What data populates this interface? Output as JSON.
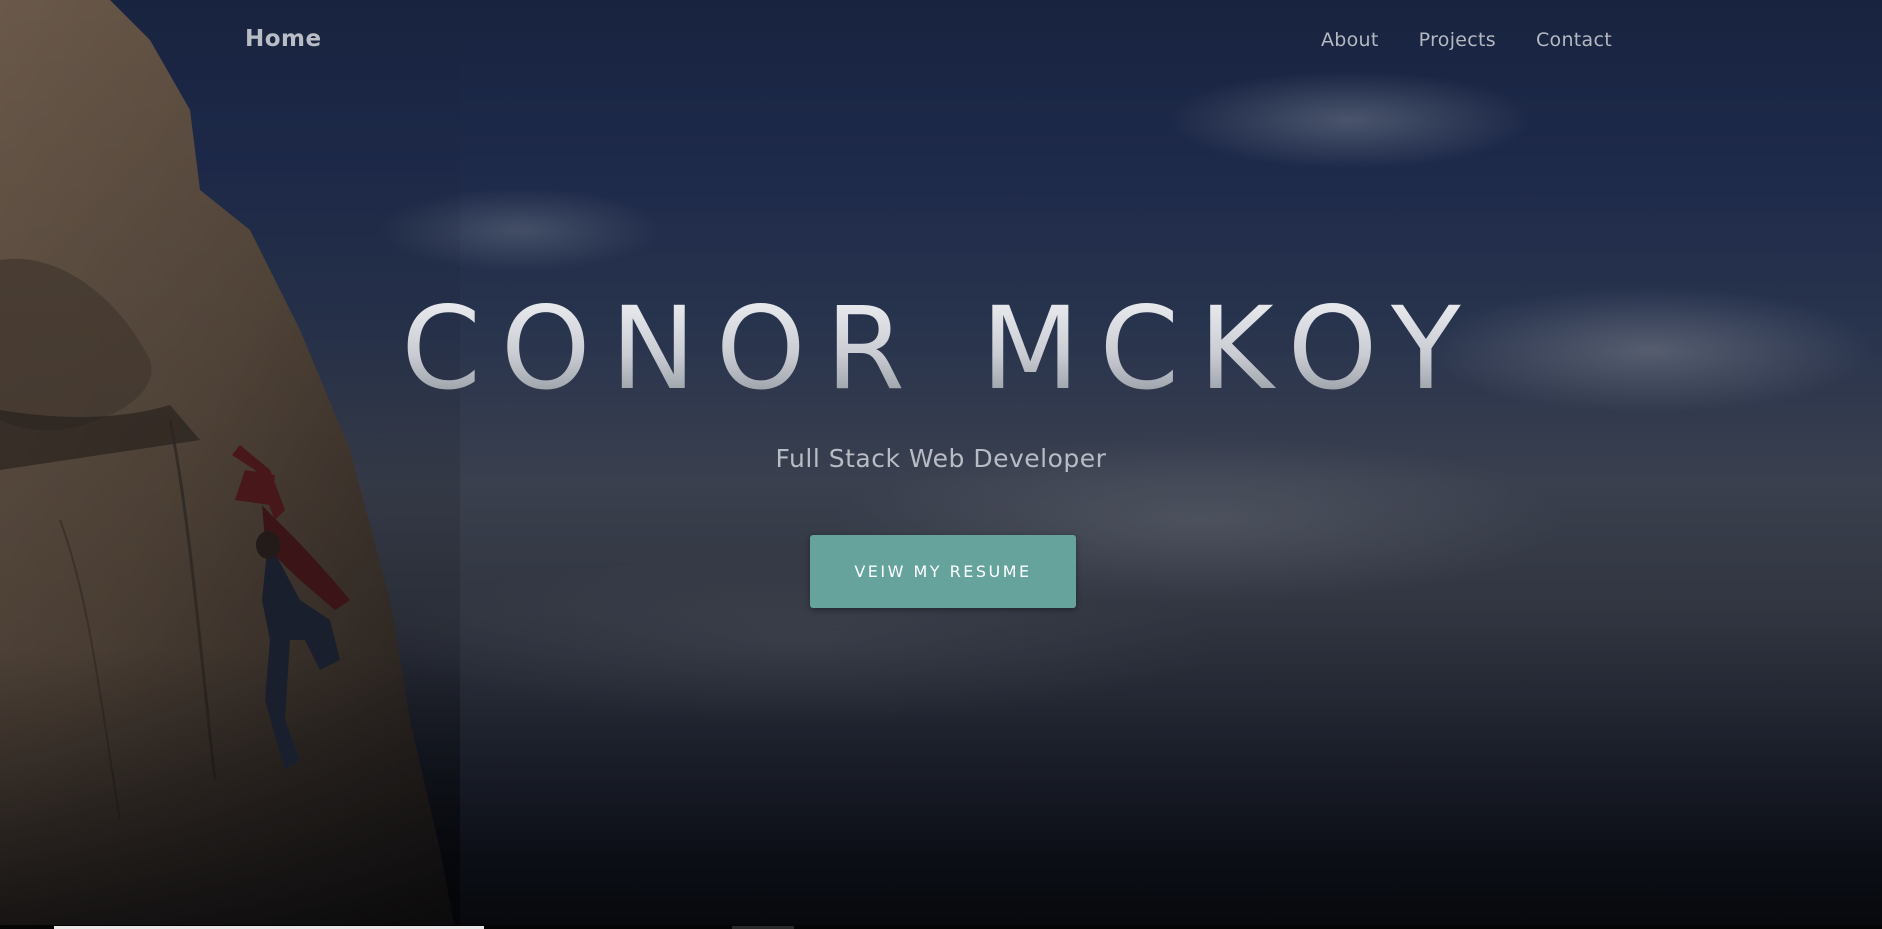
{
  "navbar": {
    "brand": "Home",
    "links": [
      {
        "label": "About"
      },
      {
        "label": "Projects"
      },
      {
        "label": "Contact"
      }
    ]
  },
  "hero": {
    "title": "CONOR MCKOY",
    "subtitle": "Full Stack Web Developer",
    "cta_label": "VEIW MY RESUME"
  },
  "colors": {
    "accent": "#66a39d",
    "nav_text": "#b4b8c1",
    "sky_top": "#1d2a4c",
    "sky_bottom": "#050608"
  }
}
